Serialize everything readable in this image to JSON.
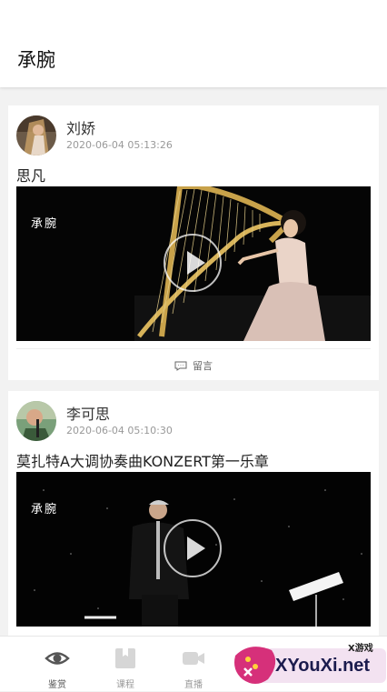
{
  "header": {
    "title": "承腕"
  },
  "posts": [
    {
      "author": "刘娇",
      "timestamp": "2020-06-04 05:13:26",
      "title": "思凡",
      "watermark": "承腕",
      "comment_label": "留言"
    },
    {
      "author": "李可思",
      "timestamp": "2020-06-04 05:10:30",
      "title": "莫扎特A大调协奏曲KONZERT第一乐章",
      "watermark": "承腕"
    }
  ],
  "bottom_nav": {
    "items": [
      {
        "label": "鉴赏",
        "icon": "eye-icon",
        "active": true
      },
      {
        "label": "课程",
        "icon": "book-icon",
        "active": false
      },
      {
        "label": "直播",
        "icon": "video-camera-icon",
        "active": false
      }
    ]
  },
  "ad_overlay": {
    "brand": "XYouXi.net",
    "tag": "X游戏"
  },
  "colors": {
    "background": "#f2f2f2",
    "card": "#ffffff",
    "video": "#000000",
    "muted": "#999999"
  }
}
